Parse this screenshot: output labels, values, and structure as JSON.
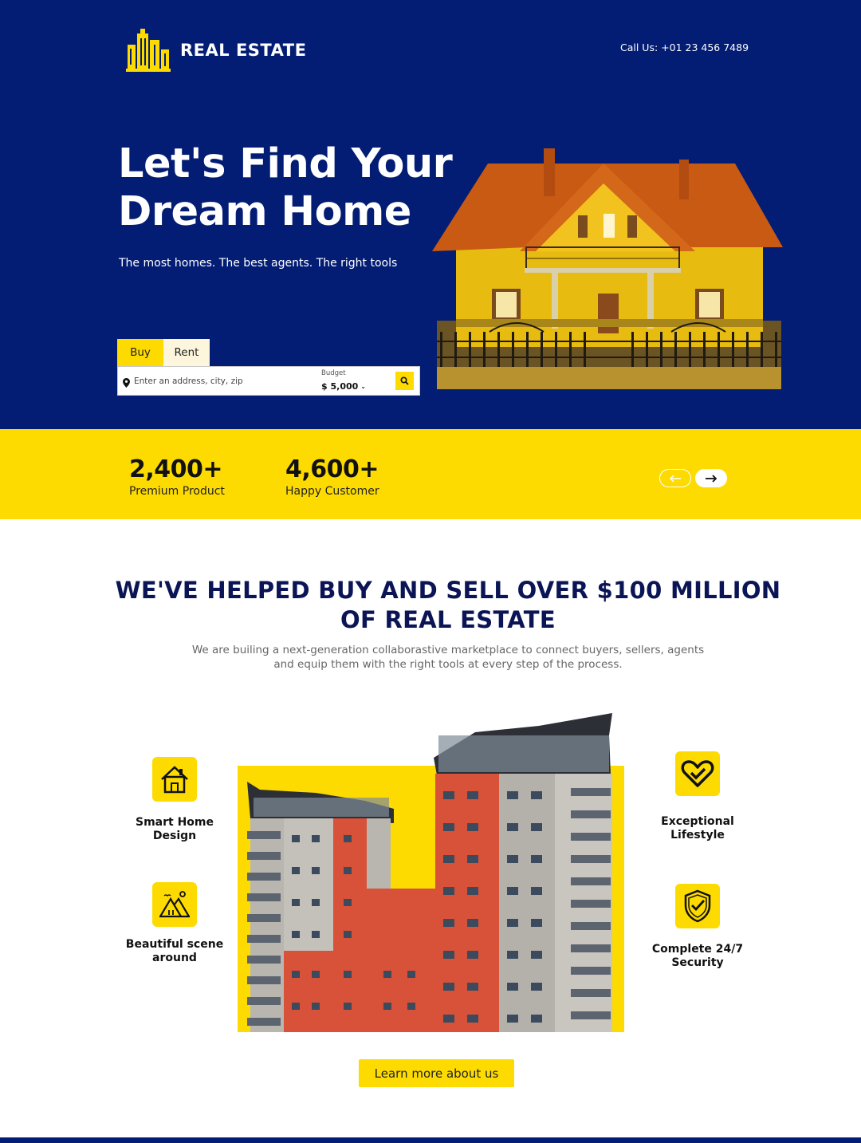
{
  "brand": {
    "name": "REAL ESTATE",
    "logo_icon": "buildings-logo-icon"
  },
  "header": {
    "call_label": "Call Us: +01 23 456 7489"
  },
  "hero": {
    "headline_line1": "Let's Find Your",
    "headline_line2": "Dream Home",
    "subline": "The most homes. The best agents. The right tools",
    "image": "yellow-house-photo"
  },
  "search": {
    "tabs": [
      {
        "label": "Buy",
        "active": true
      },
      {
        "label": "Rent",
        "active": false
      }
    ],
    "placeholder": "Enter an address, city, zip",
    "budget_label": "Budget",
    "budget_value": "$ 5,000",
    "search_icon": "search-icon"
  },
  "stats": [
    {
      "value": "2,400+",
      "label": "Premium Product"
    },
    {
      "value": "4,600+",
      "label": "Happy Customer"
    }
  ],
  "about": {
    "title_line1": "WE'VE HELPED BUY AND SELL OVER $100 MILLION",
    "title_line2": "OF REAL ESTATE",
    "text_line1": "We are builing a next-generation collaborastive marketplace to connect buyers, sellers, agents",
    "text_line2": "and equip them with the right tools at every step of the process.",
    "image": "apartment-building-photo"
  },
  "features": [
    {
      "label": "Smart Home Design",
      "icon": "house-icon"
    },
    {
      "label_line1": "Beautiful scene",
      "label_line2": "around",
      "icon": "mountain-scene-icon"
    },
    {
      "label": "Exceptional Lifestyle",
      "icon": "heart-icon"
    },
    {
      "label": "Complete 24/7 Security",
      "icon": "shield-check-icon"
    }
  ],
  "cta": {
    "label": "Learn more about us"
  },
  "colors": {
    "navy": "#031d74",
    "yellow": "#fddb00",
    "title_navy": "#0b1556"
  }
}
